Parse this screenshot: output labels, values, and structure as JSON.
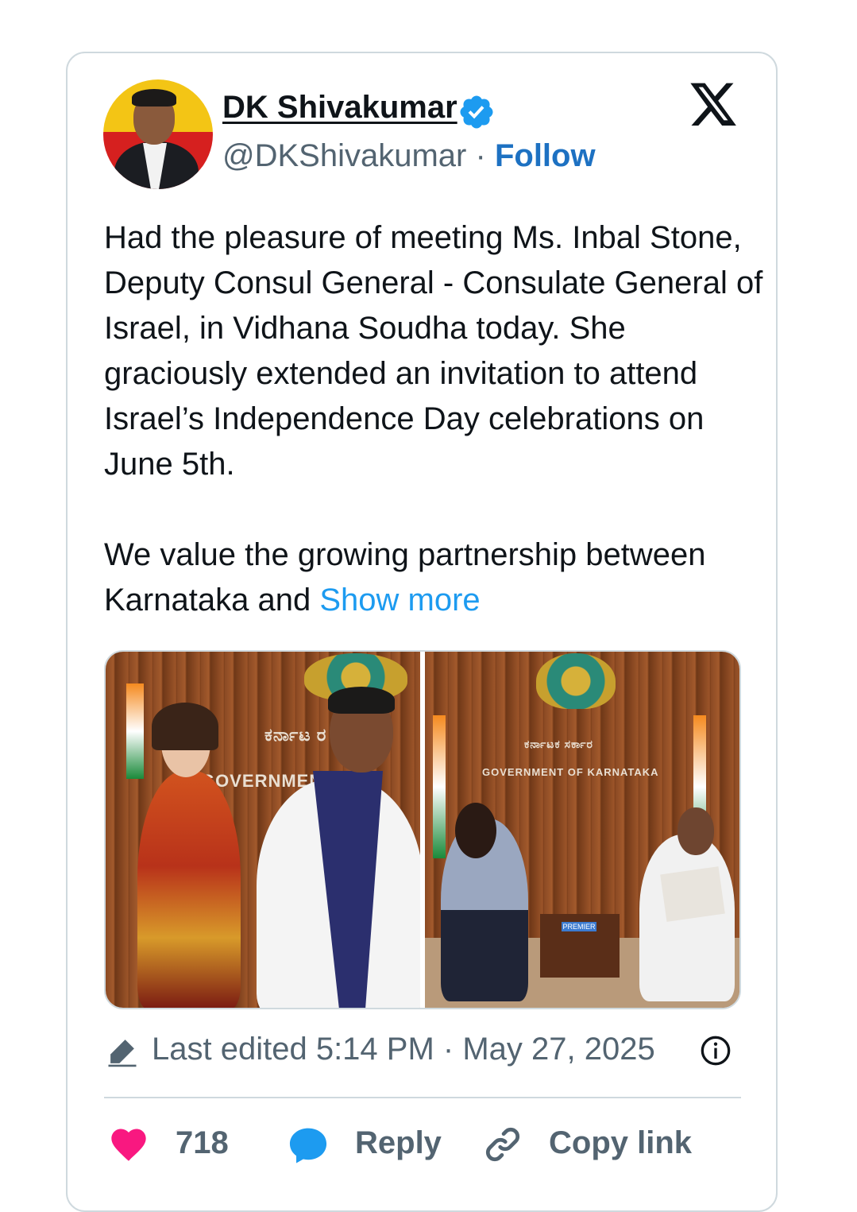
{
  "author": {
    "name": "DK Shivakumar",
    "handle": "@DKShivakumar",
    "separator": "·",
    "follow_label": "Follow",
    "verified": true
  },
  "platform_icon": "x-logo-icon",
  "tweet": {
    "paragraph1": "Had the pleasure of meeting Ms. Inbal Stone, Deputy Consul General - Consulate General of Israel, in Vidhana Soudha today. She graciously extended an invitation to attend Israel’s Independence Day celebrations on June 5th.",
    "paragraph2": "We value the growing partnership between Karnataka and",
    "show_more": "Show more"
  },
  "media": {
    "photo1": {
      "wall_text_kannada": "ಕರ್ನಾಟ         ರ",
      "wall_text_english": "GOVERNMENT      AR"
    },
    "photo2": {
      "wall_text_kannada": "ಕರ್ನಾಟಕ ಸರ್ಕಾರ",
      "wall_text_english": "GOVERNMENT OF KARNATAKA",
      "table_plaque": "PREMIER"
    }
  },
  "meta": {
    "edited_label": "Last edited 5:14 PM · May 27, 2025"
  },
  "actions": {
    "likes": "718",
    "reply_label": "Reply",
    "copy_link_label": "Copy link"
  },
  "colors": {
    "like": "#f91880",
    "reply": "#1d9bf0",
    "follow": "#1d71c2",
    "show_more": "#1d9bf0",
    "muted": "#536471",
    "border": "#cfd9de"
  }
}
